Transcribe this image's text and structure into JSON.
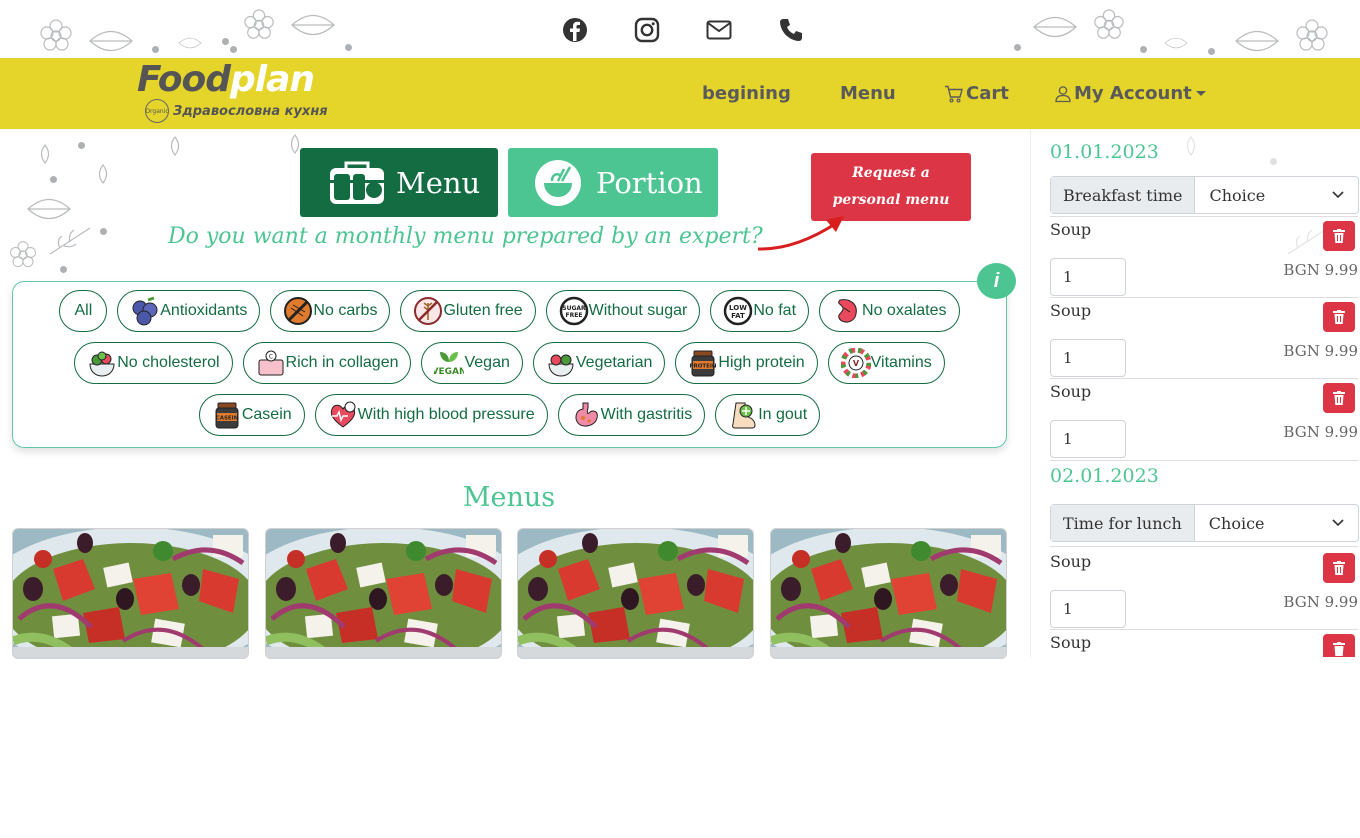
{
  "brand": {
    "name_part1": "Food",
    "name_part2": "plan",
    "tagline": "Здравословна кухня",
    "badge": "Organic"
  },
  "social": [
    "facebook-icon",
    "instagram-icon",
    "envelope-icon",
    "phone-icon"
  ],
  "nav": {
    "home": "begining",
    "menu": "Menu",
    "cart": "Cart",
    "account": "My Account"
  },
  "actions": {
    "menu": "Menu",
    "portion": "Portion",
    "request_line1": "Request a",
    "request_line2": "personal menu"
  },
  "question": "Do you want a monthly menu prepared by an expert?",
  "info_label": "i",
  "filters": {
    "row1": [
      "All",
      "Antioxidants",
      "No carbs",
      "Gluten free",
      "Without sugar",
      "No fat",
      "No oxalates"
    ],
    "row2": [
      "No cholesterol",
      "Rich in collagen",
      "Vegan",
      "Vegetarian",
      "High protein",
      "Vitamins"
    ],
    "row3": [
      "Casein",
      "With high blood pressure",
      "With gastritis",
      "In gout"
    ]
  },
  "menus_title": "Menus",
  "sidebar": {
    "day1": {
      "date": "01.01.2023",
      "meal_label": "Breakfast time",
      "select_value": "Choice",
      "items": [
        {
          "name": "Soup",
          "qty": "1",
          "price": "BGN 9.99"
        },
        {
          "name": "Soup",
          "qty": "1",
          "price": "BGN 9.99"
        },
        {
          "name": "Soup",
          "qty": "1",
          "price": "BGN 9.99"
        }
      ]
    },
    "day2": {
      "date": "02.01.2023",
      "meal_label": "Time for lunch",
      "select_value": "Choice",
      "items": [
        {
          "name": "Soup",
          "qty": "1",
          "price": "BGN 9.99"
        },
        {
          "name": "Soup"
        }
      ]
    }
  },
  "colors": {
    "header": "#e5d52a",
    "dark_green": "#146c43",
    "green": "#4cc592",
    "red": "#dc3545"
  }
}
